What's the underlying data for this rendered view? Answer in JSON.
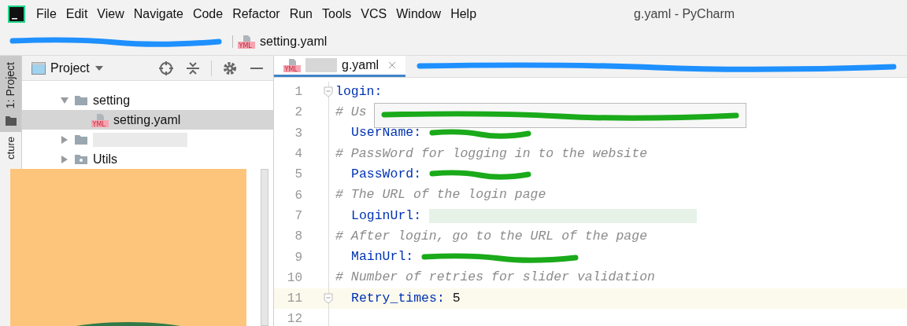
{
  "window": {
    "title": "g.yaml - PyCharm"
  },
  "menu": [
    {
      "label": "File"
    },
    {
      "label": "Edit"
    },
    {
      "label": "View"
    },
    {
      "label": "Navigate"
    },
    {
      "label": "Code"
    },
    {
      "label": "Refactor"
    },
    {
      "label": "Run"
    },
    {
      "label": "Tools"
    },
    {
      "label": "VCS"
    },
    {
      "label": "Window"
    },
    {
      "label": "Help"
    }
  ],
  "breadcrumb": {
    "icon_label": "YML",
    "file": "setting.yaml"
  },
  "side_tabs": [
    {
      "label": "1: Project",
      "selected": true
    },
    {
      "label": "cture",
      "selected": false
    }
  ],
  "project_panel": {
    "title": "Project",
    "tree": [
      {
        "label": "setting",
        "kind": "folder",
        "expanded": true,
        "children": [
          {
            "label": "setting.yaml",
            "icon_label": "YML",
            "kind": "yaml",
            "selected": true
          }
        ]
      },
      {
        "kind": "folder",
        "redacted": true,
        "expanded": false
      },
      {
        "label": "Utils",
        "kind": "package",
        "expanded": false
      }
    ]
  },
  "editor_tabs": [
    {
      "label": "g.yaml",
      "icon_label": "YML",
      "selected": true
    }
  ],
  "code": [
    {
      "number": "1",
      "kind": "root_key",
      "key": "login:",
      "fold": true,
      "current": false
    },
    {
      "number": "2",
      "kind": "comment",
      "text": "# Us",
      "current": false
    },
    {
      "number": "3",
      "kind": "key",
      "key": "UserName:",
      "redacted": true,
      "current": false
    },
    {
      "number": "4",
      "kind": "comment",
      "text": "# PassWord for logging in to the website",
      "current": false
    },
    {
      "number": "5",
      "kind": "key",
      "key": "PassWord:",
      "redacted": true,
      "current": false
    },
    {
      "number": "6",
      "kind": "comment",
      "text": "# The URL of the login page",
      "current": false
    },
    {
      "number": "7",
      "kind": "key",
      "key": "LoginUrl:",
      "blurred": true,
      "current": false
    },
    {
      "number": "8",
      "kind": "comment",
      "text": "# After login, go to the URL of the page",
      "current": false
    },
    {
      "number": "9",
      "kind": "key",
      "key": "MainUrl:",
      "redacted": true,
      "current": false
    },
    {
      "number": "10",
      "kind": "comment",
      "text": "# Number of retries for slider validation",
      "current": false
    },
    {
      "number": "11",
      "kind": "key",
      "key": "Retry_times:",
      "value": "5",
      "current": true,
      "fold": true
    },
    {
      "number": "12",
      "kind": "blank",
      "current": false
    }
  ]
}
